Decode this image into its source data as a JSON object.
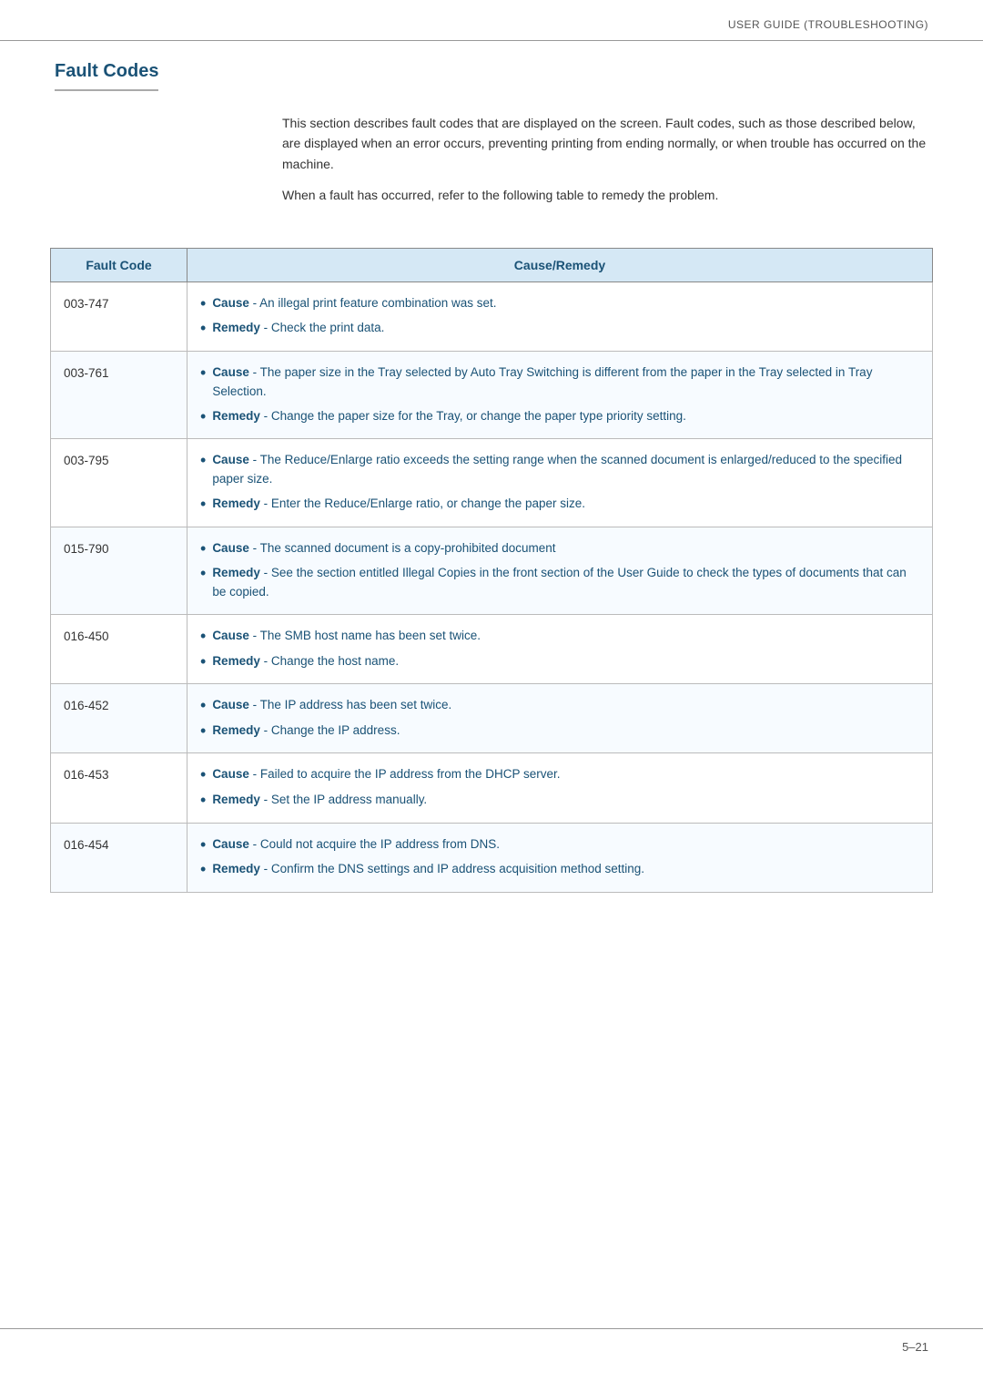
{
  "header": {
    "title": "User Guide (Troubleshooting)"
  },
  "section": {
    "title": "Fault Codes"
  },
  "intro": {
    "para1": "This section describes fault codes that are displayed on the screen. Fault codes, such as those described below, are displayed when an error occurs, preventing printing from ending normally, or when trouble has occurred on the machine.",
    "para2": "When a fault has occurred, refer to the following table to remedy the problem."
  },
  "table": {
    "col1_header": "Fault Code",
    "col2_header": "Cause/Remedy",
    "rows": [
      {
        "code": "003-747",
        "items": [
          {
            "type": "Cause",
            "text": " - An illegal print feature combination was set."
          },
          {
            "type": "Remedy",
            "text": " - Check the print data."
          }
        ]
      },
      {
        "code": "003-761",
        "items": [
          {
            "type": "Cause",
            "text": " - The paper size in the Tray selected by Auto Tray Switching is different from the paper in the Tray selected in Tray Selection."
          },
          {
            "type": "Remedy",
            "text": " - Change the paper size for the Tray, or change the paper type priority setting."
          }
        ]
      },
      {
        "code": "003-795",
        "items": [
          {
            "type": "Cause",
            "text": " - The Reduce/Enlarge ratio exceeds the setting range when the scanned document is enlarged/reduced to the specified paper size."
          },
          {
            "type": "Remedy",
            "text": " - Enter the Reduce/Enlarge ratio, or change the paper size."
          }
        ]
      },
      {
        "code": "015-790",
        "items": [
          {
            "type": "Cause",
            "text": " - The scanned document is a copy-prohibited document"
          },
          {
            "type": "Remedy",
            "text": " - See the section entitled Illegal Copies in the front section of the User Guide to check the types of documents that can be copied."
          }
        ]
      },
      {
        "code": "016-450",
        "items": [
          {
            "type": "Cause",
            "text": " - The SMB host name has been set twice."
          },
          {
            "type": "Remedy",
            "text": " - Change the host name."
          }
        ]
      },
      {
        "code": "016-452",
        "items": [
          {
            "type": "Cause",
            "text": " - The IP address has been set twice."
          },
          {
            "type": "Remedy",
            "text": " - Change the IP address."
          }
        ]
      },
      {
        "code": "016-453",
        "items": [
          {
            "type": "Cause",
            "text": " - Failed to acquire the IP address from the DHCP server."
          },
          {
            "type": "Remedy",
            "text": " - Set the IP address manually."
          }
        ]
      },
      {
        "code": "016-454",
        "items": [
          {
            "type": "Cause",
            "text": " - Could not acquire the IP address from DNS."
          },
          {
            "type": "Remedy",
            "text": " - Confirm the DNS settings and IP address acquisition method setting."
          }
        ]
      }
    ]
  },
  "footer": {
    "page": "5–21"
  }
}
